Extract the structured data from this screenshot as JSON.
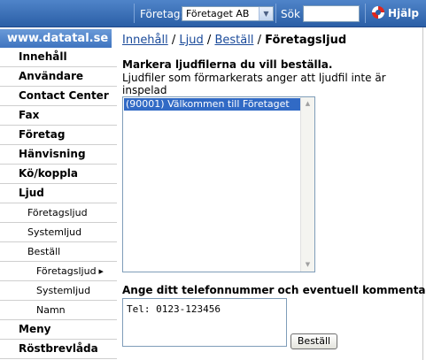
{
  "topbar": {
    "company_label": "Företag:",
    "company_value": "Företaget AB",
    "search_label": "Sök",
    "search_value": "",
    "help_label": "Hjälp"
  },
  "logo": "www.datatal.se",
  "menu": [
    {
      "label": "Innehåll",
      "level": 1
    },
    {
      "label": "Användare",
      "level": 1
    },
    {
      "label": "Contact Center",
      "level": 1
    },
    {
      "label": "Fax",
      "level": 1
    },
    {
      "label": "Företag",
      "level": 1
    },
    {
      "label": "Hänvisning",
      "level": 1
    },
    {
      "label": "Kö/koppla",
      "level": 1
    },
    {
      "label": "Ljud",
      "level": 1
    },
    {
      "label": "Företagsljud",
      "level": 2
    },
    {
      "label": "Systemljud",
      "level": 2
    },
    {
      "label": "Beställ",
      "level": 2
    },
    {
      "label": "Företagsljud",
      "level": 3,
      "active": true
    },
    {
      "label": "Systemljud",
      "level": 3
    },
    {
      "label": "Namn",
      "level": 3
    },
    {
      "label": "Meny",
      "level": 1
    },
    {
      "label": "Röstbrevlåda",
      "level": 1
    }
  ],
  "breadcrumb": {
    "items": [
      "Innehåll",
      "Ljud",
      "Beställ"
    ],
    "separator": "/",
    "current": "Företagsljud"
  },
  "form": {
    "title": "Markera ljudfilerna du vill beställa.",
    "description": "Ljudfiler som förmarkerats anger att ljudfil inte är inspelad",
    "listbox_options": [
      "(90001) Välkommen till Företaget"
    ],
    "phone_title": "Ange ditt telefonnummer och eventuell kommentar",
    "phone_value": "Tel: 0123-123456",
    "order_button": "Beställ"
  },
  "colors": {
    "topbar": "#2b5fa6",
    "selection": "#316ac5",
    "link": "#1a4a9a"
  }
}
